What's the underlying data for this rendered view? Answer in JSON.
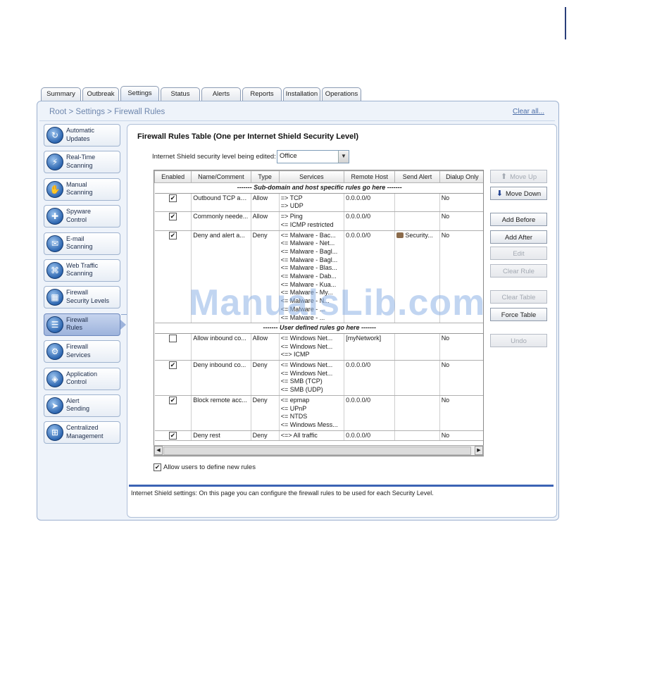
{
  "tabs": [
    {
      "label": "Summary",
      "w": 55,
      "active": false
    },
    {
      "label": "Outbreak",
      "w": 50,
      "active": false
    },
    {
      "label": "Settings",
      "w": 53,
      "active": true
    },
    {
      "label": "Status",
      "w": 54,
      "active": false
    },
    {
      "label": "Alerts",
      "w": 54,
      "active": false
    },
    {
      "label": "Reports",
      "w": 54,
      "active": false
    },
    {
      "label": "Installation",
      "w": 51,
      "active": false
    },
    {
      "label": "Operations",
      "w": 54,
      "active": false
    }
  ],
  "breadcrumb": {
    "root": "Root",
    "sep1": " > ",
    "settings": "Settings",
    "sep2": " > ",
    "current": "Firewall Rules"
  },
  "clear_all": "Clear all...",
  "sidebar": [
    {
      "line1": "Automatic",
      "line2": "Updates",
      "icon": "update-icon",
      "active": false
    },
    {
      "line1": "Real-Time",
      "line2": "Scanning",
      "icon": "realtime-scan-icon",
      "active": false
    },
    {
      "line1": "Manual",
      "line2": "Scanning",
      "icon": "manual-scan-icon",
      "active": false
    },
    {
      "line1": "Spyware",
      "line2": "Control",
      "icon": "spyware-icon",
      "active": false
    },
    {
      "line1": "E-mail",
      "line2": "Scanning",
      "icon": "email-icon",
      "active": false
    },
    {
      "line1": "Web Traffic",
      "line2": "Scanning",
      "icon": "web-traffic-icon",
      "active": false
    },
    {
      "line1": "Firewall",
      "line2": "Security Levels",
      "icon": "firewall-levels-icon",
      "active": false
    },
    {
      "line1": "Firewall",
      "line2": "Rules",
      "icon": "firewall-rules-icon",
      "active": true
    },
    {
      "line1": "Firewall",
      "line2": "Services",
      "icon": "firewall-services-icon",
      "active": false
    },
    {
      "line1": "Application",
      "line2": "Control",
      "icon": "application-icon",
      "active": false
    },
    {
      "line1": "Alert",
      "line2": "Sending",
      "icon": "alert-sending-icon",
      "active": false
    },
    {
      "line1": "Centralized",
      "line2": "Management",
      "icon": "central-mgmt-icon",
      "active": false
    }
  ],
  "content": {
    "title": "Firewall Rules Table (One per Internet Shield Security Level)",
    "level_label": "Internet Shield security level being edited:",
    "level_value": "Office"
  },
  "table": {
    "headers": [
      "Enabled",
      "Name/Comment",
      "Type",
      "Services",
      "Remote Host",
      "Send Alert",
      "Dialup Only"
    ],
    "separator_top": "------- Sub-domain and host specific rules go here -------",
    "separator_user": "------- User defined rules go here -------",
    "rows_top": [
      {
        "enabled": true,
        "name": "Outbound TCP an...",
        "type": "Allow",
        "services": [
          "=>  TCP",
          "=>  UDP"
        ],
        "host": "0.0.0.0/0",
        "alert": "",
        "dialup": "No"
      },
      {
        "enabled": true,
        "name": "Commonly neede...",
        "type": "Allow",
        "services": [
          "=>  Ping",
          "<=  ICMP restricted"
        ],
        "host": "0.0.0.0/0",
        "alert": "",
        "dialup": "No"
      },
      {
        "enabled": true,
        "name": "Deny and alert a...",
        "type": "Deny",
        "services": [
          "<=  Malware - Bac...",
          "<=  Malware - Net...",
          "<=  Malware - Bagl...",
          "<=  Malware - Bagl...",
          "<=  Malware - Blas...",
          "<=  Malware - Dab...",
          "<=  Malware - Kua...",
          "<=  Malware - My...",
          "<=  Malware - N...",
          "<=  Malware - ...",
          "<=  Malware - ..."
        ],
        "host": "0.0.0.0/0",
        "alert": "Security...",
        "dialup": "No"
      }
    ],
    "rows_user": [
      {
        "enabled": false,
        "name": "Allow inbound co...",
        "type": "Allow",
        "services": [
          "<=  Windows Net...",
          "<=  Windows Net...",
          "<=> ICMP"
        ],
        "host": "[myNetwork]",
        "alert": "",
        "dialup": "No"
      },
      {
        "enabled": true,
        "name": "Deny inbound co...",
        "type": "Deny",
        "services": [
          "<=  Windows Net...",
          "<=  Windows Net...",
          "<=  SMB (TCP)",
          "<=  SMB (UDP)"
        ],
        "host": "0.0.0.0/0",
        "alert": "",
        "dialup": "No"
      },
      {
        "enabled": true,
        "name": "Block remote acc...",
        "type": "Deny",
        "services": [
          "<=  epmap",
          "<=  UPnP",
          "<=  NTDS",
          "<=  Windows Mess..."
        ],
        "host": "0.0.0.0/0",
        "alert": "",
        "dialup": "No"
      },
      {
        "enabled": true,
        "name": "Deny rest",
        "type": "Deny",
        "services": [
          "<=> All traffic"
        ],
        "host": "0.0.0.0/0",
        "alert": "",
        "dialup": "No"
      }
    ]
  },
  "buttons": {
    "move_up": "Move Up",
    "move_down": "Move Down",
    "add_before": "Add Before",
    "add_after": "Add After",
    "edit": "Edit",
    "clear_rule": "Clear Rule",
    "clear_table": "Clear Table",
    "force_table": "Force Table",
    "undo": "Undo"
  },
  "allow_users": {
    "label": "Allow users to define new rules",
    "checked": true
  },
  "status_text": "Internet Shield settings: On this page you can configure the firewall rules to be used for each Security Level.",
  "watermark": "ManualsLib.com"
}
